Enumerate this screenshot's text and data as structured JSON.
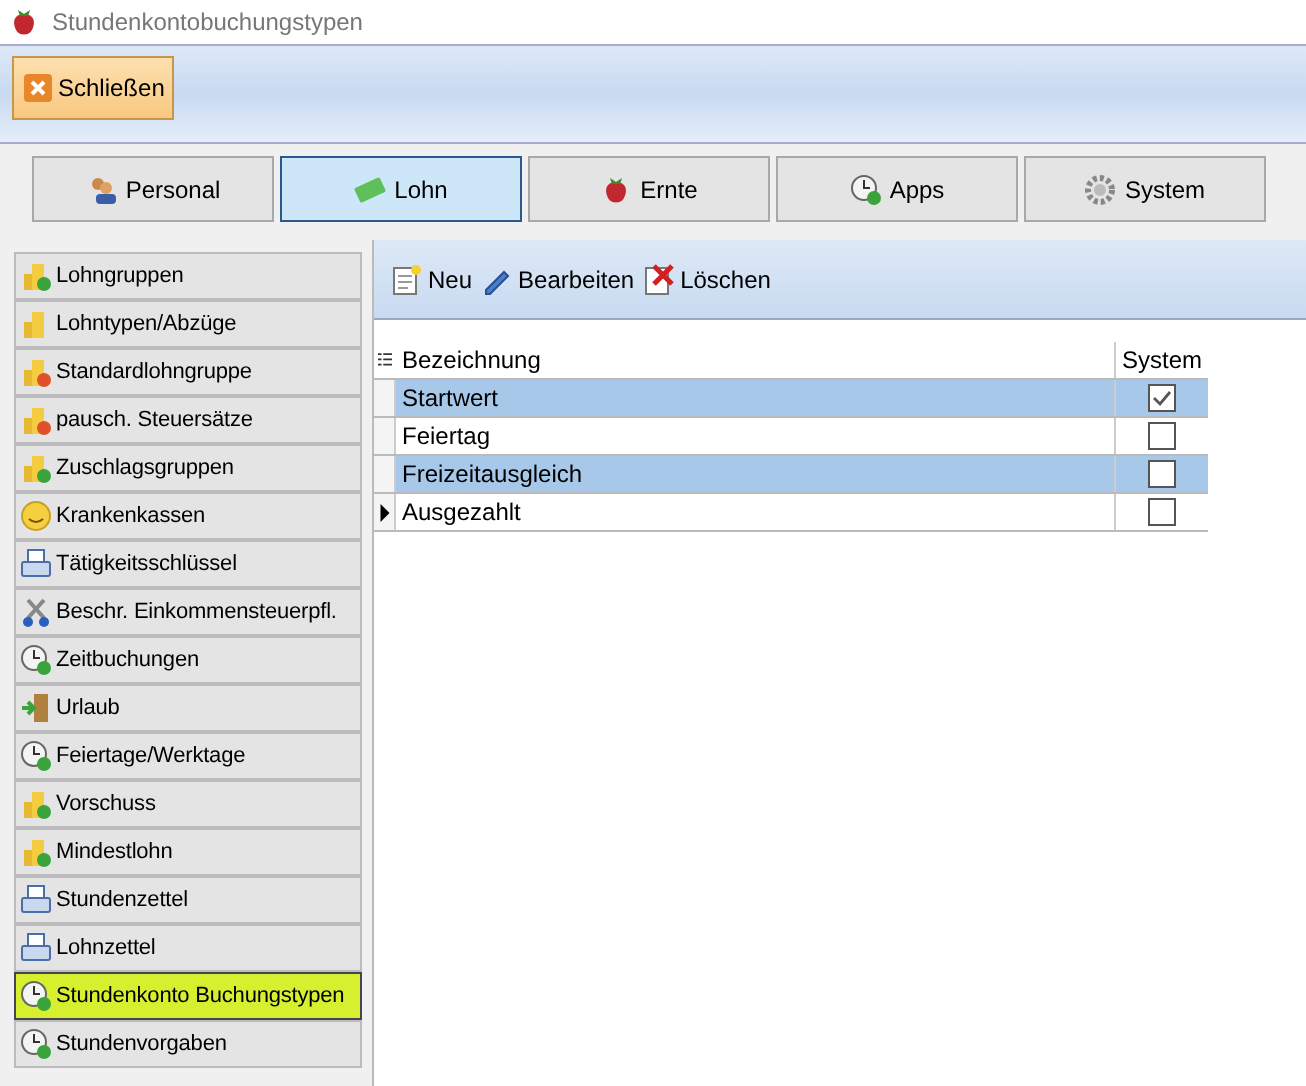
{
  "window": {
    "title": "Stundenkontobuchungstypen"
  },
  "toolbar": {
    "close_button": "Schließen"
  },
  "tabs": [
    {
      "label": "Personal",
      "kind": "people",
      "selected": false
    },
    {
      "label": "Lohn",
      "kind": "money",
      "selected": true
    },
    {
      "label": "Ernte",
      "kind": "strawberry",
      "selected": false
    },
    {
      "label": "Apps",
      "kind": "clock",
      "selected": false
    },
    {
      "label": "System",
      "kind": "gear",
      "selected": false
    }
  ],
  "sidebar": {
    "items": [
      {
        "label": "Lohngruppen",
        "kind": "coins-plus",
        "selected": false
      },
      {
        "label": "Lohntypen/Abzüge",
        "kind": "coins",
        "selected": false
      },
      {
        "label": "Standardlohngruppe",
        "kind": "coins-minus",
        "selected": false
      },
      {
        "label": "pausch. Steuersätze",
        "kind": "coins-minus",
        "selected": false
      },
      {
        "label": "Zuschlagsgruppen",
        "kind": "coins-plus",
        "selected": false
      },
      {
        "label": "Krankenkassen",
        "kind": "smiley",
        "selected": false
      },
      {
        "label": "Tätigkeitsschlüssel",
        "kind": "printer",
        "selected": false
      },
      {
        "label": "Beschr. Einkommensteuerpfl.",
        "kind": "scissors",
        "selected": false
      },
      {
        "label": "Zeitbuchungen",
        "kind": "clock",
        "selected": false
      },
      {
        "label": "Urlaub",
        "kind": "door",
        "selected": false
      },
      {
        "label": "Feiertage/Werktage",
        "kind": "clock",
        "selected": false
      },
      {
        "label": "Vorschuss",
        "kind": "coins-plus",
        "selected": false
      },
      {
        "label": "Mindestlohn",
        "kind": "coins-plus",
        "selected": false
      },
      {
        "label": "Stundenzettel",
        "kind": "printer",
        "selected": false
      },
      {
        "label": "Lohnzettel",
        "kind": "printer",
        "selected": false
      },
      {
        "label": "Stundenkonto Buchungstypen",
        "kind": "clock",
        "selected": true
      },
      {
        "label": "Stundenvorgaben",
        "kind": "clock",
        "selected": false
      }
    ]
  },
  "actions": [
    {
      "label": "Neu",
      "kind": "new"
    },
    {
      "label": "Bearbeiten",
      "kind": "edit"
    },
    {
      "label": "Löschen",
      "kind": "delete"
    }
  ],
  "table": {
    "columns": [
      "Bezeichnung",
      "System"
    ],
    "rows": [
      {
        "name": "Startwert",
        "system": true,
        "selected": true,
        "current": false
      },
      {
        "name": "Feiertag",
        "system": false,
        "selected": false,
        "current": false
      },
      {
        "name": "Freizeitausgleich",
        "system": false,
        "selected": true,
        "current": false
      },
      {
        "name": "Ausgezahlt",
        "system": false,
        "selected": false,
        "current": true
      }
    ]
  }
}
